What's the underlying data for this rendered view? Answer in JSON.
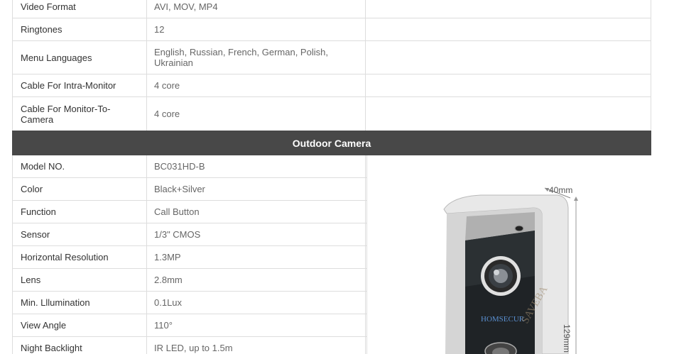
{
  "top_rows": [
    {
      "key": "Video Format",
      "value": "AVI, MOV, MP4"
    },
    {
      "key": "Ringtones",
      "value": "12"
    },
    {
      "key": "Menu Languages",
      "value": "English, Russian, French, German, Polish, Ukrainian"
    },
    {
      "key": "Cable For Intra-Monitor",
      "value": "4 core"
    },
    {
      "key": "Cable For Monitor-To-Camera",
      "value": "4 core"
    }
  ],
  "section_title": "Outdoor Camera",
  "bottom_rows": [
    {
      "key": "Model NO.",
      "value": "BC031HD-B"
    },
    {
      "key": "Color",
      "value": "Black+Silver"
    },
    {
      "key": "Function",
      "value": "Call Button"
    },
    {
      "key": "Sensor",
      "value": "1/3\" CMOS"
    },
    {
      "key": "Horizontal Resolution",
      "value": "1.3MP"
    },
    {
      "key": "Lens",
      "value": "2.8mm"
    },
    {
      "key": "Min. Lllumination",
      "value": "0.1Lux"
    },
    {
      "key": "View Angle",
      "value": "110°"
    },
    {
      "key": "Night Backlight",
      "value": "IR LED, up to 1.5m"
    }
  ],
  "product_image": {
    "brand": "HOMSECUR",
    "watermark": "SAVEBA",
    "depth_label": "40mm",
    "height_label": "129mm"
  }
}
